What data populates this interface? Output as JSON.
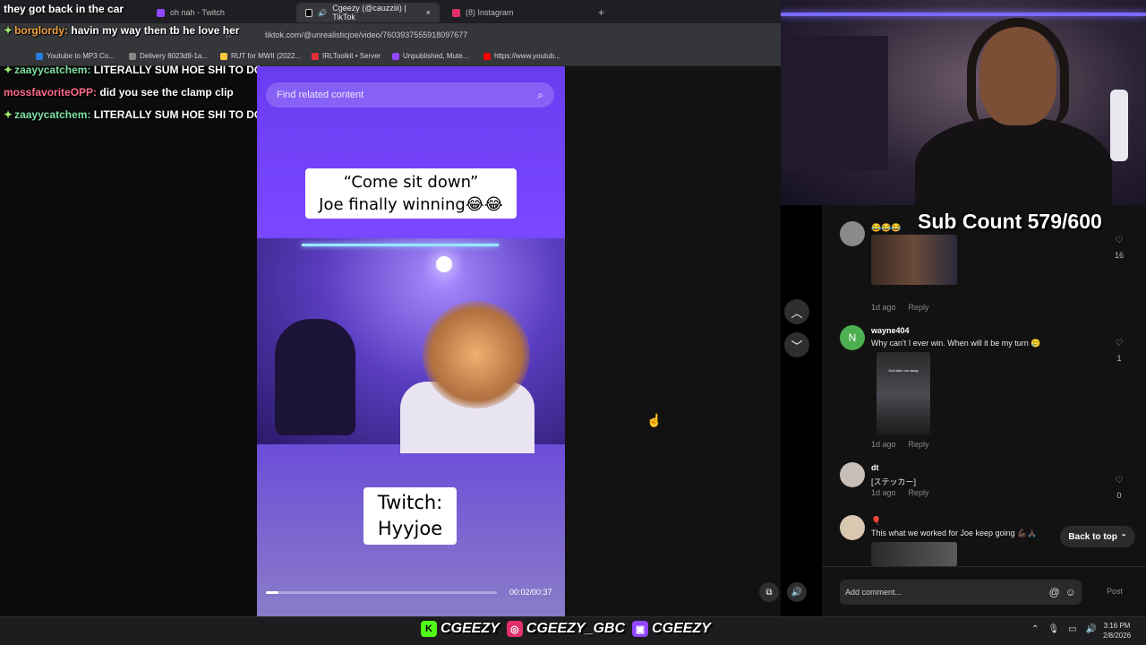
{
  "browser": {
    "tabs": [
      {
        "label": "oh nah - Twitch",
        "active": false
      },
      {
        "label": "Cgeezy (@cauzziii) | TikTok",
        "active": true
      },
      {
        "label": "(8) Instagram",
        "active": false
      }
    ],
    "new_tab": "+",
    "close_tab": "×",
    "url": "tiktok.com/@unrealisticjoe/video/7603937555918097677",
    "bookmarks": [
      {
        "label": "Youtube to MP3 Co...",
        "color": "#2a7de1"
      },
      {
        "label": "Delivery 8023d9-1a...",
        "color": "#888888"
      },
      {
        "label": "RUT for MWII (2022...",
        "color": "#ffc83d"
      },
      {
        "label": "IRLToolkit • Server",
        "color": "#e0303a"
      },
      {
        "label": "Unpublished, Mute...",
        "color": "#9146ff"
      },
      {
        "label": "https://www.youtub...",
        "color": "#ff0000"
      }
    ]
  },
  "chat": {
    "title": "they got back in the car",
    "messages": [
      {
        "user": "borglordy",
        "sep": ":",
        "text": "havin my way then tb he love her",
        "color": "orange"
      },
      {
        "user": "zaayycatchem",
        "sep": ":",
        "text": "LITERALLY SUM HOE SHI TO DO",
        "color": "green"
      },
      {
        "user": "mossfavoriteOPP",
        "sep": ":",
        "text": "did you see the clamp clip",
        "color": "pink"
      },
      {
        "user": "zaayycatchem",
        "sep": ":",
        "text": "LITERALLY SUM HOE SHI TO DO",
        "color": "green"
      }
    ]
  },
  "video": {
    "search_placeholder": "Find related content",
    "caption_top_line1": "“Come sit down”",
    "caption_top_line2": "Joe finally winning😂😂",
    "caption_bottom_line1": "Twitch:",
    "caption_bottom_line2": "Hyyjoe",
    "time": "00:02/00:37",
    "progress": 0.054
  },
  "overlay": {
    "sub_count": "Sub Count 579/600"
  },
  "comments": [
    {
      "user": "",
      "text": "😂😂😂",
      "time": "1d ago",
      "reply": "Reply",
      "likes": "16",
      "avatar_color": "#8a8a8a"
    },
    {
      "user": "wayne404",
      "text": "Why can't I ever win. When will it be my turn 🥲",
      "time": "1d ago",
      "reply": "Reply",
      "likes": "1",
      "avatar_color": "#4caf50",
      "avatar_letter": "N"
    },
    {
      "user": "dt",
      "text": "[ステッカー]",
      "time": "1d ago",
      "reply": "Reply",
      "likes": "0",
      "avatar_color": "#c8c0b8"
    },
    {
      "user": "🎈",
      "text": "This what we worked for Joe keep going 💪🏿🙏🏿",
      "time": "",
      "reply": "",
      "likes": "",
      "avatar_color": "#d8c8b0"
    }
  ],
  "comment_images": {
    "gif_caption": "God take me away"
  },
  "back_to_top": "Back to top",
  "comment_bar": {
    "placeholder": "Add comment...",
    "post": "Post"
  },
  "taskbar": {
    "handles": [
      {
        "text": "CGEEZY",
        "badge": "K",
        "color": "#53fc18"
      },
      {
        "text": "CGEEZY_GBC",
        "badge": "◎",
        "color": "#e1306c"
      },
      {
        "text": "CGEEZY",
        "badge": "▣",
        "color": "#9146ff"
      }
    ],
    "time": "3:16 PM",
    "date": "2/8/2026"
  }
}
